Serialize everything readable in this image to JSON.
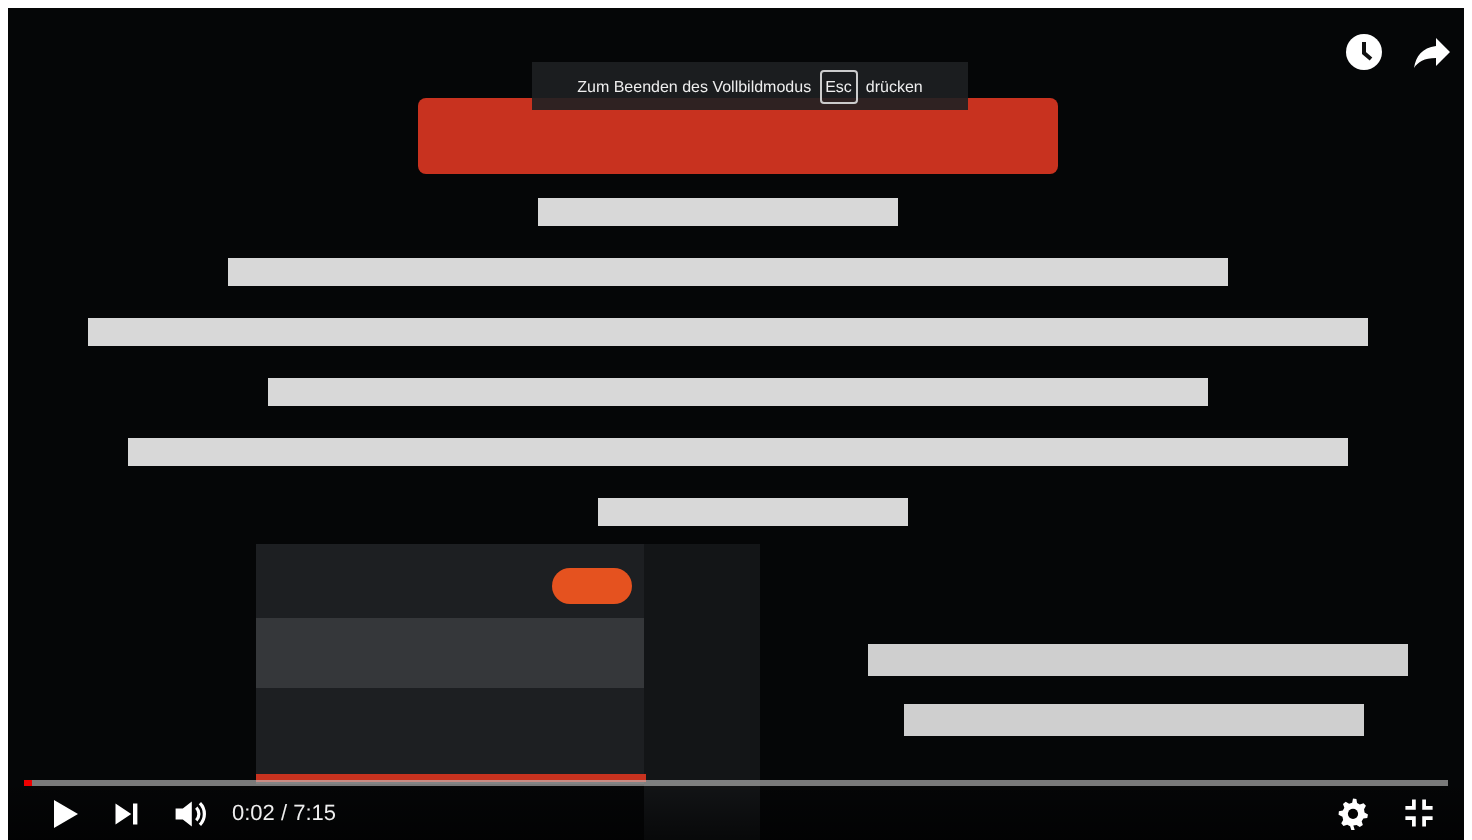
{
  "fullscreen_hint": {
    "before": "Zum Beenden des Vollbildmodus",
    "key": "Esc",
    "after": "drücken"
  },
  "progress": {
    "level": 0.005
  },
  "time": "0:02 / 7:15"
}
